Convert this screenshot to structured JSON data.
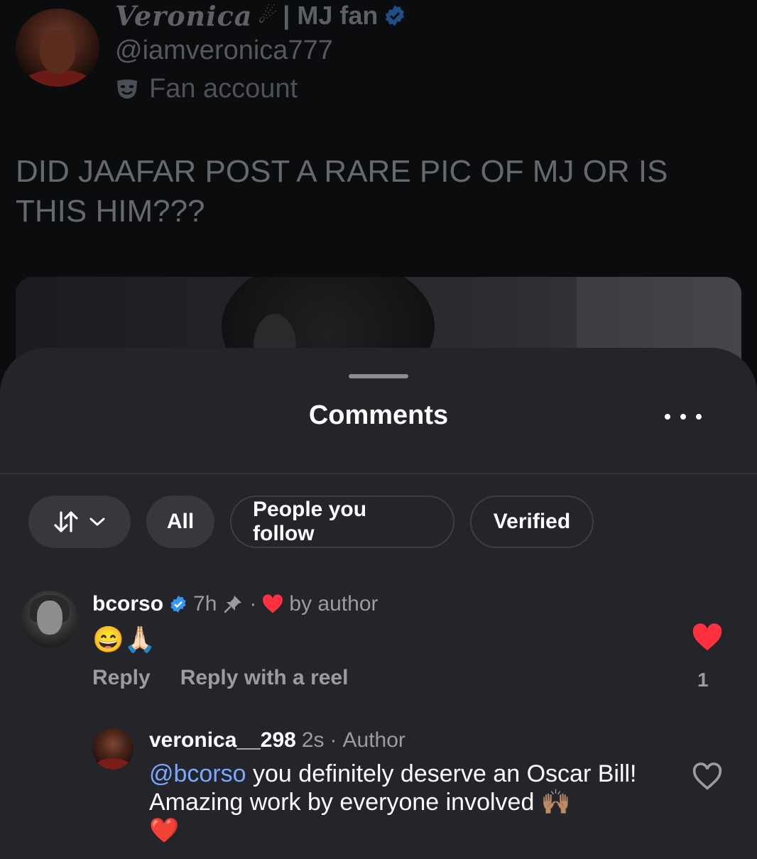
{
  "post": {
    "display_name": "Veronica",
    "name_suffix": "| MJ fan",
    "handle": "@iamveronica777",
    "account_tag": "Fan account",
    "text": "DID JAAFAR POST A RARE PIC OF MJ OR IS THIS HIM???"
  },
  "sheet": {
    "title": "Comments",
    "filters": [
      {
        "label": "All"
      },
      {
        "label": "People you follow"
      },
      {
        "label": "Verified"
      }
    ]
  },
  "comments": [
    {
      "username": "bcorso",
      "verified": true,
      "time": "7h",
      "liked_label": "by author",
      "text": "😄🙏🏻",
      "reply_label": "Reply",
      "reel_label": "Reply with a reel",
      "likes": "1",
      "liked": true
    }
  ],
  "reply": {
    "username": "veronica__298",
    "time": "2s",
    "badge": "Author",
    "mention": "@bcorso",
    "text": " you definitely deserve an Oscar Bill! Amazing work by everyone involved 🙌🏽",
    "heart": "❤️"
  },
  "colors": {
    "verified_blue": "#3897f0",
    "like_red": "#ff3040",
    "mention_blue": "#7aa7ff",
    "sheet_bg": "#24252a"
  },
  "icons": [
    "verified-badge-icon",
    "comet-icon",
    "fan-mask-icon",
    "sort-icon",
    "chevron-down-icon",
    "more-icon",
    "pin-icon",
    "heart-icon"
  ]
}
